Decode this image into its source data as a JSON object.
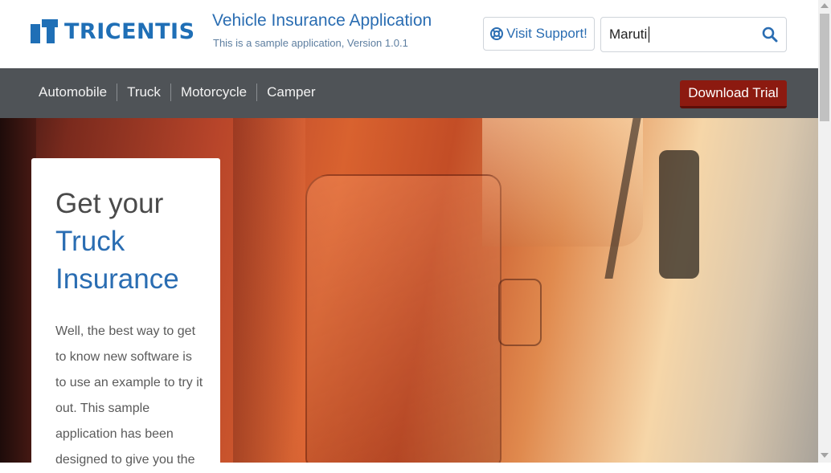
{
  "header": {
    "logo_text": "TRICENTIS",
    "title": "Vehicle Insurance Application",
    "subtitle": "This is a sample application, Version 1.0.1",
    "support_label": "Visit Support!",
    "search": {
      "value": "Maruti",
      "icon": "search-icon"
    }
  },
  "nav": {
    "items": [
      {
        "label": "Automobile"
      },
      {
        "label": "Truck"
      },
      {
        "label": "Motorcycle"
      },
      {
        "label": "Camper"
      }
    ],
    "download_label": "Download Trial"
  },
  "hero": {
    "line1": "Get your",
    "line2": "Truck Insurance",
    "body": "Well, the best way to get to know new software is to use an example to try it out. This sample application has been designed to give you the"
  },
  "colors": {
    "brand_blue": "#1f6fb6",
    "navbar": "#4f5357",
    "download_red": "#8c1a10"
  }
}
